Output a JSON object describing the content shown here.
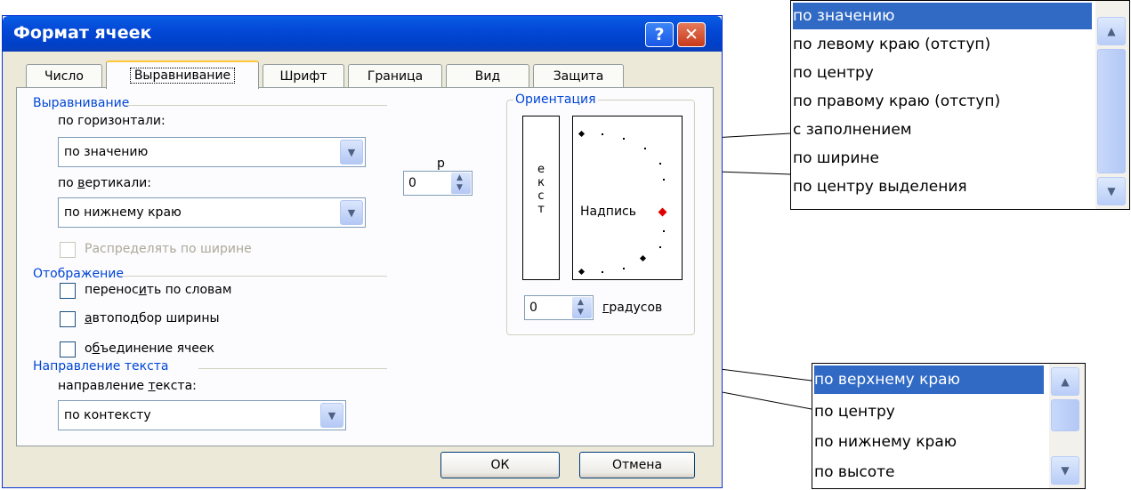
{
  "dialog": {
    "title": "Формат ячеек",
    "help_label": "?",
    "close_label": "✕",
    "tabs": [
      {
        "label": "Число"
      },
      {
        "label": "Выравнивание"
      },
      {
        "label": "Шрифт"
      },
      {
        "label": "Граница"
      },
      {
        "label": "Вид"
      },
      {
        "label": "Защита"
      }
    ],
    "alignment": {
      "group_label": "Выравнивание",
      "horizontal_label": "по горизонтали:",
      "horizontal_value": "по значению",
      "vertical_label_pre": "по ",
      "vertical_label_u": "в",
      "vertical_label_post": "ертикали:",
      "vertical_value": "по нижнему краю",
      "indent_value": "0",
      "indent_label_fragment": "р",
      "distribute_label": "Распределять по ширине"
    },
    "orientation": {
      "group_label": "Ориентация",
      "vertical_text": [
        "е",
        "к",
        "с",
        "т"
      ],
      "label": "Надпись",
      "degrees_value": "0",
      "degrees_label_u": "г",
      "degrees_label_rest": "радусов"
    },
    "display": {
      "group_label": "Отображение",
      "wrap_pre": "перенос",
      "wrap_u": "и",
      "wrap_post": "ть по словам",
      "autofit_u": "а",
      "autofit_post": "втоподбор ширины",
      "merge_pre": "о",
      "merge_u": "б",
      "merge_post": "ъединение ячеек"
    },
    "direction": {
      "group_label": "Направление текста",
      "label_pre": "направление ",
      "label_u": "т",
      "label_post": "екста:",
      "value": "по контексту"
    },
    "ok_label": "ОК",
    "cancel_label": "Отмена"
  },
  "horizontal_popup": {
    "options": [
      "по значению",
      "по левому краю (отступ)",
      "по центру",
      "по правому краю (отступ)",
      "с заполнением",
      "по ширине",
      "по центру выделения"
    ],
    "selected_index": 0
  },
  "vertical_popup": {
    "options": [
      "по верхнему краю",
      "по центру",
      "по нижнему краю",
      "по высоте"
    ],
    "selected_index": 0
  },
  "colors": {
    "title_bar": "#0348d6",
    "group_label": "#0046d5",
    "selection": "#316ac5",
    "dialog_bg": "#ece9d8"
  },
  "icons": {
    "scroll_up": "▲",
    "scroll_down": "▼",
    "dropdown": "▼"
  }
}
